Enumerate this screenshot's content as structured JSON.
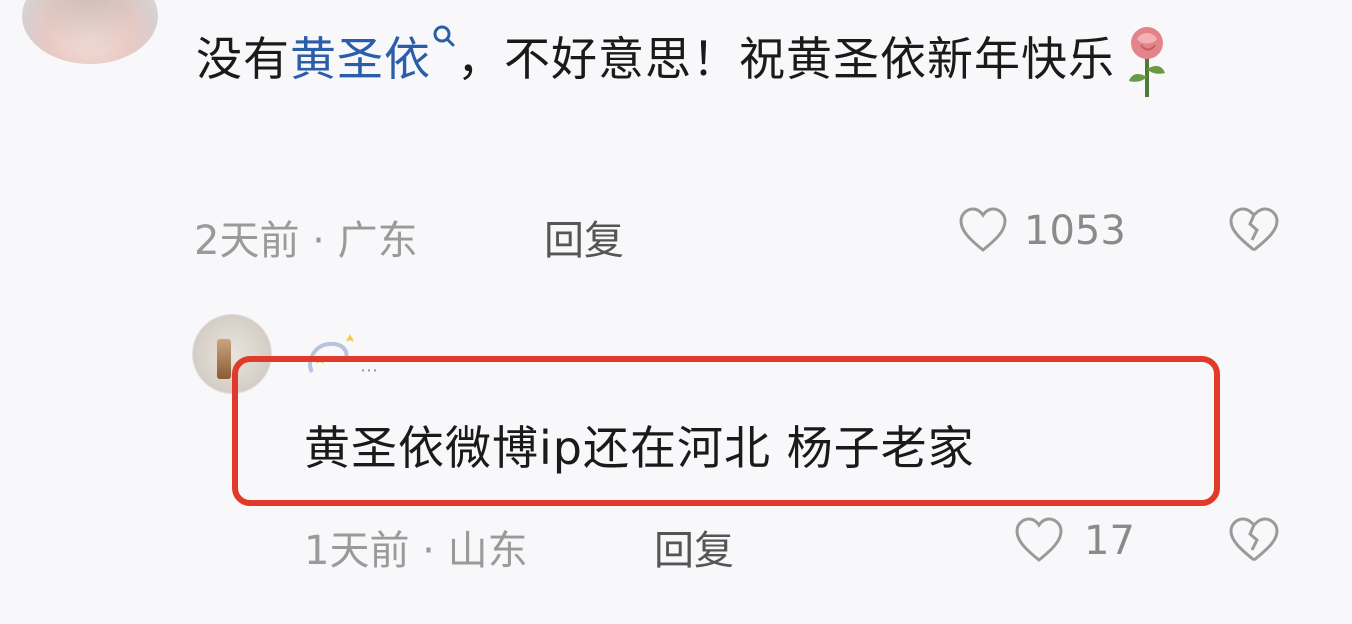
{
  "comments": [
    {
      "text_before": "没有",
      "mention": "黄圣依",
      "text_after": "，不好意思！祝黄圣依新年快乐",
      "emoji": "rose",
      "time": "2天前 · 广东",
      "reply_label": "回复",
      "likes": "1053"
    },
    {
      "username": "⋯",
      "text": "黄圣依微博ip还在河北 杨子老家",
      "time": "1天前 · 山东",
      "reply_label": "回复",
      "likes": "17"
    }
  ],
  "colors": {
    "mention": "#2a5ea8",
    "highlight": "#e23a2a",
    "meta": "#9a9a9a"
  },
  "icons": [
    "search-icon",
    "rose-emoji-icon",
    "heart-icon",
    "broken-heart-icon"
  ]
}
